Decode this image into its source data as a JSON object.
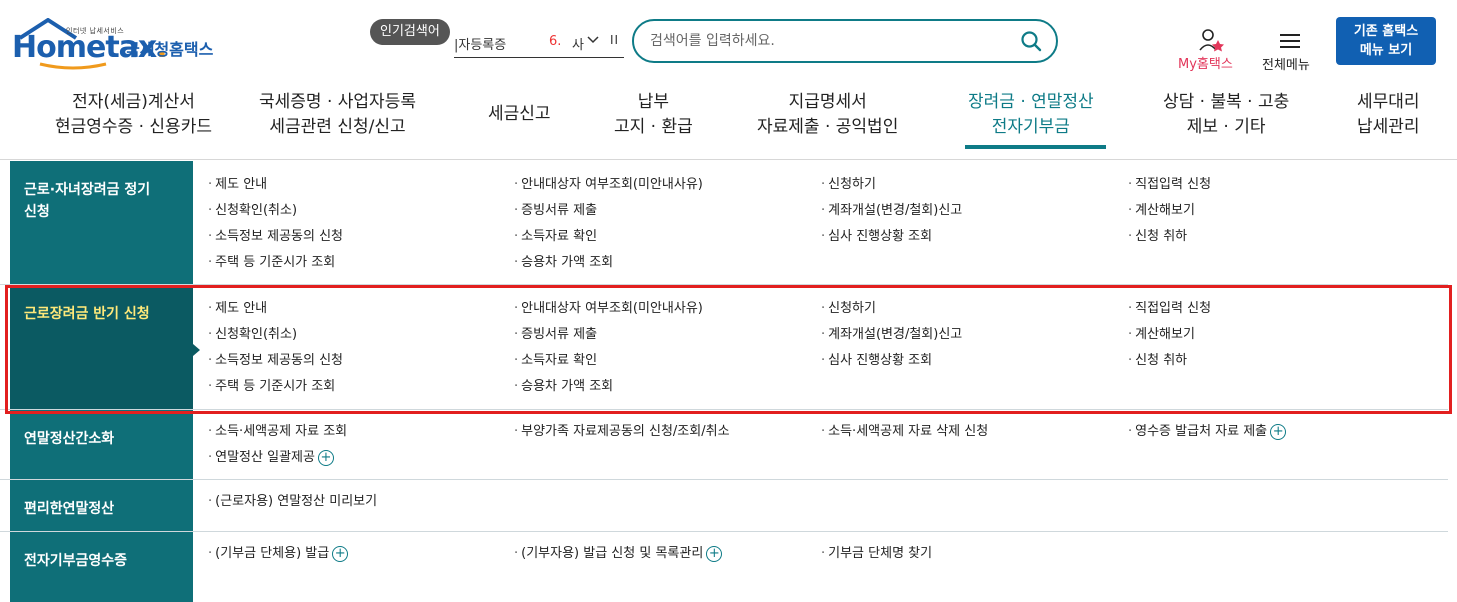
{
  "header": {
    "logo_tagline": "인터넷 납세서비스",
    "logo_word_a": "Hom",
    "logo_word_b": "e",
    "logo_word_c": "tax",
    "logo_dot": ".",
    "logo_korean": "국세청홈택스",
    "popular_badge": "인기검색어",
    "popular_item": "|자등록증",
    "popular_rank": "6.",
    "popular_word": "사",
    "popular_pause": "II",
    "search_placeholder": "검색어를 입력하세요.",
    "my_hometax": "My홈택스",
    "all_menu": "전체메뉴",
    "legacy_line1": "기존 홈택스",
    "legacy_line2": "메뉴 보기"
  },
  "gnb": [
    {
      "l1": "전자(세금)계산서",
      "l2": "현금영수증 · 신용카드"
    },
    {
      "l1": "국세증명 · 사업자등록",
      "l2": "세금관련 신청/신고"
    },
    {
      "l1": "세금신고",
      "l2": ""
    },
    {
      "l1": "납부",
      "l2": "고지 · 환급"
    },
    {
      "l1": "지급명세서",
      "l2": "자료제출 · 공익법인"
    },
    {
      "l1": "장려금 · 연말정산",
      "l2": "전자기부금"
    },
    {
      "l1": "상담 · 불복 · 고충",
      "l2": "제보 · 기타"
    },
    {
      "l1": "세무대리",
      "l2": "납세관리"
    }
  ],
  "sections": [
    {
      "title": "근로·자녀장려금 정기 신청",
      "title_l1": "근로·자녀장려금 정기",
      "title_l2": "신청",
      "items": [
        "제도 안내",
        "안내대상자 여부조회(미안내사유)",
        "신청하기",
        "직접입력 신청",
        "신청확인(취소)",
        "증빙서류 제출",
        "계좌개설(변경/철회)신고",
        "계산해보기",
        "소득정보 제공동의 신청",
        "소득자료 확인",
        "심사 진행상황 조회",
        "신청 취하",
        "주택 등 기준시가 조회",
        "승용차 가액 조회"
      ]
    },
    {
      "title": "근로장려금 반기 신청",
      "items": [
        "제도 안내",
        "안내대상자 여부조회(미안내사유)",
        "신청하기",
        "직접입력 신청",
        "신청확인(취소)",
        "증빙서류 제출",
        "계좌개설(변경/철회)신고",
        "계산해보기",
        "소득정보 제공동의 신청",
        "소득자료 확인",
        "심사 진행상황 조회",
        "신청 취하",
        "주택 등 기준시가 조회",
        "승용차 가액 조회"
      ]
    },
    {
      "title": "연말정산간소화",
      "items": [
        "소득·세액공제 자료 조회",
        "부양가족 자료제공동의 신청/조회/취소",
        "소득·세액공제 자료 삭제 신청",
        "영수증 발급처 자료 제출",
        "연말정산 일괄제공"
      ]
    },
    {
      "title": "편리한연말정산",
      "items": [
        "(근로자용) 연말정산 미리보기"
      ]
    },
    {
      "title": "전자기부금영수증",
      "items": [
        "(기부금 단체용) 발급",
        "(기부자용) 발급 신청 및 목록관리",
        "기부금 단체명 찾기"
      ]
    }
  ],
  "bullet": "·",
  "plus": "+"
}
